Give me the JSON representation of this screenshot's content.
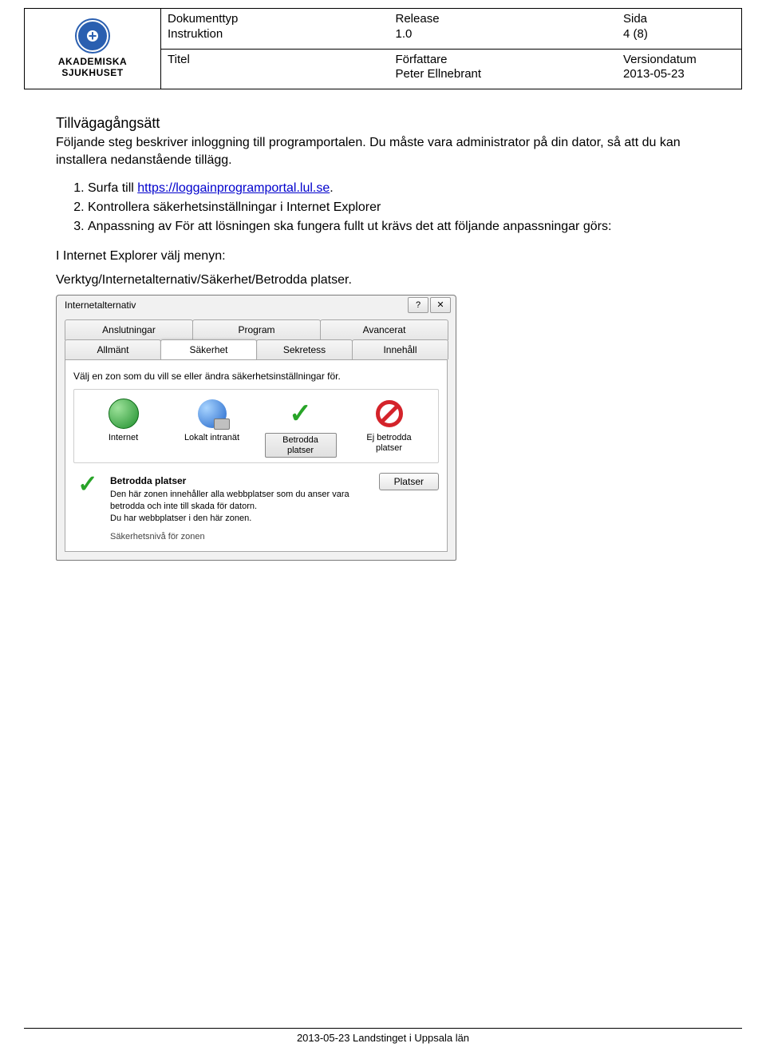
{
  "logo": {
    "line1": "AKADEMISKA",
    "line2": "SJUKHUSET"
  },
  "header": {
    "doctype_label": "Dokumenttyp",
    "doctype_value": "Instruktion",
    "release_label": "Release",
    "release_value": "1.0",
    "page_label": "Sida",
    "page_value": "4 (8)",
    "title_label": "Titel",
    "author_label": "Författare",
    "author_value": "Peter Ellnebrant",
    "version_label": "Versiondatum",
    "version_value": "2013-05-23"
  },
  "body": {
    "heading": "Tillvägagångsätt",
    "intro": "Följande steg beskriver inloggning till programportalen. Du måste vara administrator på din dator, så att du kan installera nedanstående tillägg.",
    "steps": {
      "s1_prefix": "Surfa till ",
      "s1_link": "https://loggainprogramportal.lul.se",
      "s1_suffix": ".",
      "s2": "Kontrollera säkerhetsinställningar i Internet Explorer",
      "s3": "Anpassning av  För att lösningen ska fungera fullt ut krävs det att följande anpassningar görs:"
    },
    "sub1": "I Internet Explorer välj menyn:",
    "sub2": "Verktyg/Internetalternativ/Säkerhet/Betrodda platser."
  },
  "dialog": {
    "title": "Internetalternativ",
    "help": "?",
    "close": "✕",
    "tabs": {
      "top": [
        "Anslutningar",
        "Program",
        "Avancerat"
      ],
      "bottom": [
        "Allmänt",
        "Säkerhet",
        "Sekretess",
        "Innehåll"
      ]
    },
    "zone_caption": "Välj en zon som du vill se eller ändra säkerhetsinställningar för.",
    "zones": [
      "Internet",
      "Lokalt intranät",
      "Betrodda platser",
      "Ej betrodda platser"
    ],
    "desc_title": "Betrodda platser",
    "desc_body": "Den här zonen innehåller alla webbplatser som du anser vara betrodda och inte till skada för datorn.\nDu har webbplatser i den här zonen.",
    "sites_button": "Platser",
    "cutline": "Säkerhetsnivå för zonen"
  },
  "footer": "2013-05-23 Landstinget i Uppsala län"
}
